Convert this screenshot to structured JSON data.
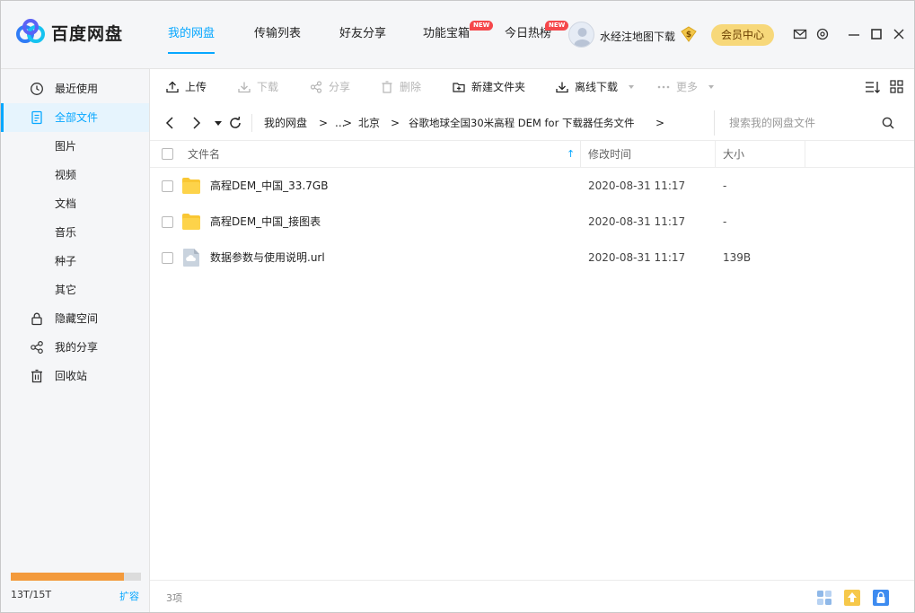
{
  "app": {
    "name": "百度网盘"
  },
  "nav": {
    "tabs": [
      {
        "label": "我的网盘",
        "active": true
      },
      {
        "label": "传输列表"
      },
      {
        "label": "好友分享"
      },
      {
        "label": "功能宝箱",
        "badge": "NEW"
      },
      {
        "label": "今日热榜",
        "badge": "NEW"
      }
    ]
  },
  "user": {
    "name": "水经注地图下载",
    "vip_symbol": "$",
    "member_center": "会员中心"
  },
  "sidebar": {
    "items": [
      {
        "label": "最近使用",
        "icon": "clock-icon"
      },
      {
        "label": "全部文件",
        "icon": "document-icon",
        "active": true
      },
      {
        "label": "图片"
      },
      {
        "label": "视频"
      },
      {
        "label": "文档"
      },
      {
        "label": "音乐"
      },
      {
        "label": "种子"
      },
      {
        "label": "其它"
      },
      {
        "label": "隐藏空间",
        "icon": "lock-icon"
      },
      {
        "label": "我的分享",
        "icon": "share-icon"
      },
      {
        "label": "回收站",
        "icon": "trash-icon"
      }
    ],
    "quota": {
      "text": "13T/15T",
      "used_fraction": 0.8667,
      "expand": "扩容"
    }
  },
  "toolbar": {
    "upload": "上传",
    "download": "下载",
    "share": "分享",
    "delete": "删除",
    "new_folder": "新建文件夹",
    "offline_download": "离线下载",
    "more": "更多"
  },
  "breadcrumb": {
    "items": [
      "我的网盘",
      "...",
      "北京",
      "谷歌地球全国30米高程 DEM for 下载器任务文件"
    ],
    "separator": ">"
  },
  "search": {
    "placeholder": "搜索我的网盘文件"
  },
  "table": {
    "headers": {
      "name": "文件名",
      "modified": "修改时间",
      "size": "大小"
    },
    "sort_indicator": "↑",
    "rows": [
      {
        "name": "高程DEM_中国_33.7GB",
        "modified": "2020-08-31 11:17",
        "size": "-",
        "type": "folder"
      },
      {
        "name": "高程DEM_中国_接图表",
        "modified": "2020-08-31 11:17",
        "size": "-",
        "type": "folder"
      },
      {
        "name": "数据参数与使用说明.url",
        "modified": "2020-08-31 11:17",
        "size": "139B",
        "type": "url-file"
      }
    ]
  },
  "status": {
    "count": "3项"
  },
  "colors": {
    "accent": "#06a7ff",
    "folder": "#f9c734",
    "quota": "#f39a3c",
    "badge": "#f5474b",
    "vip": "#f7d87a"
  }
}
